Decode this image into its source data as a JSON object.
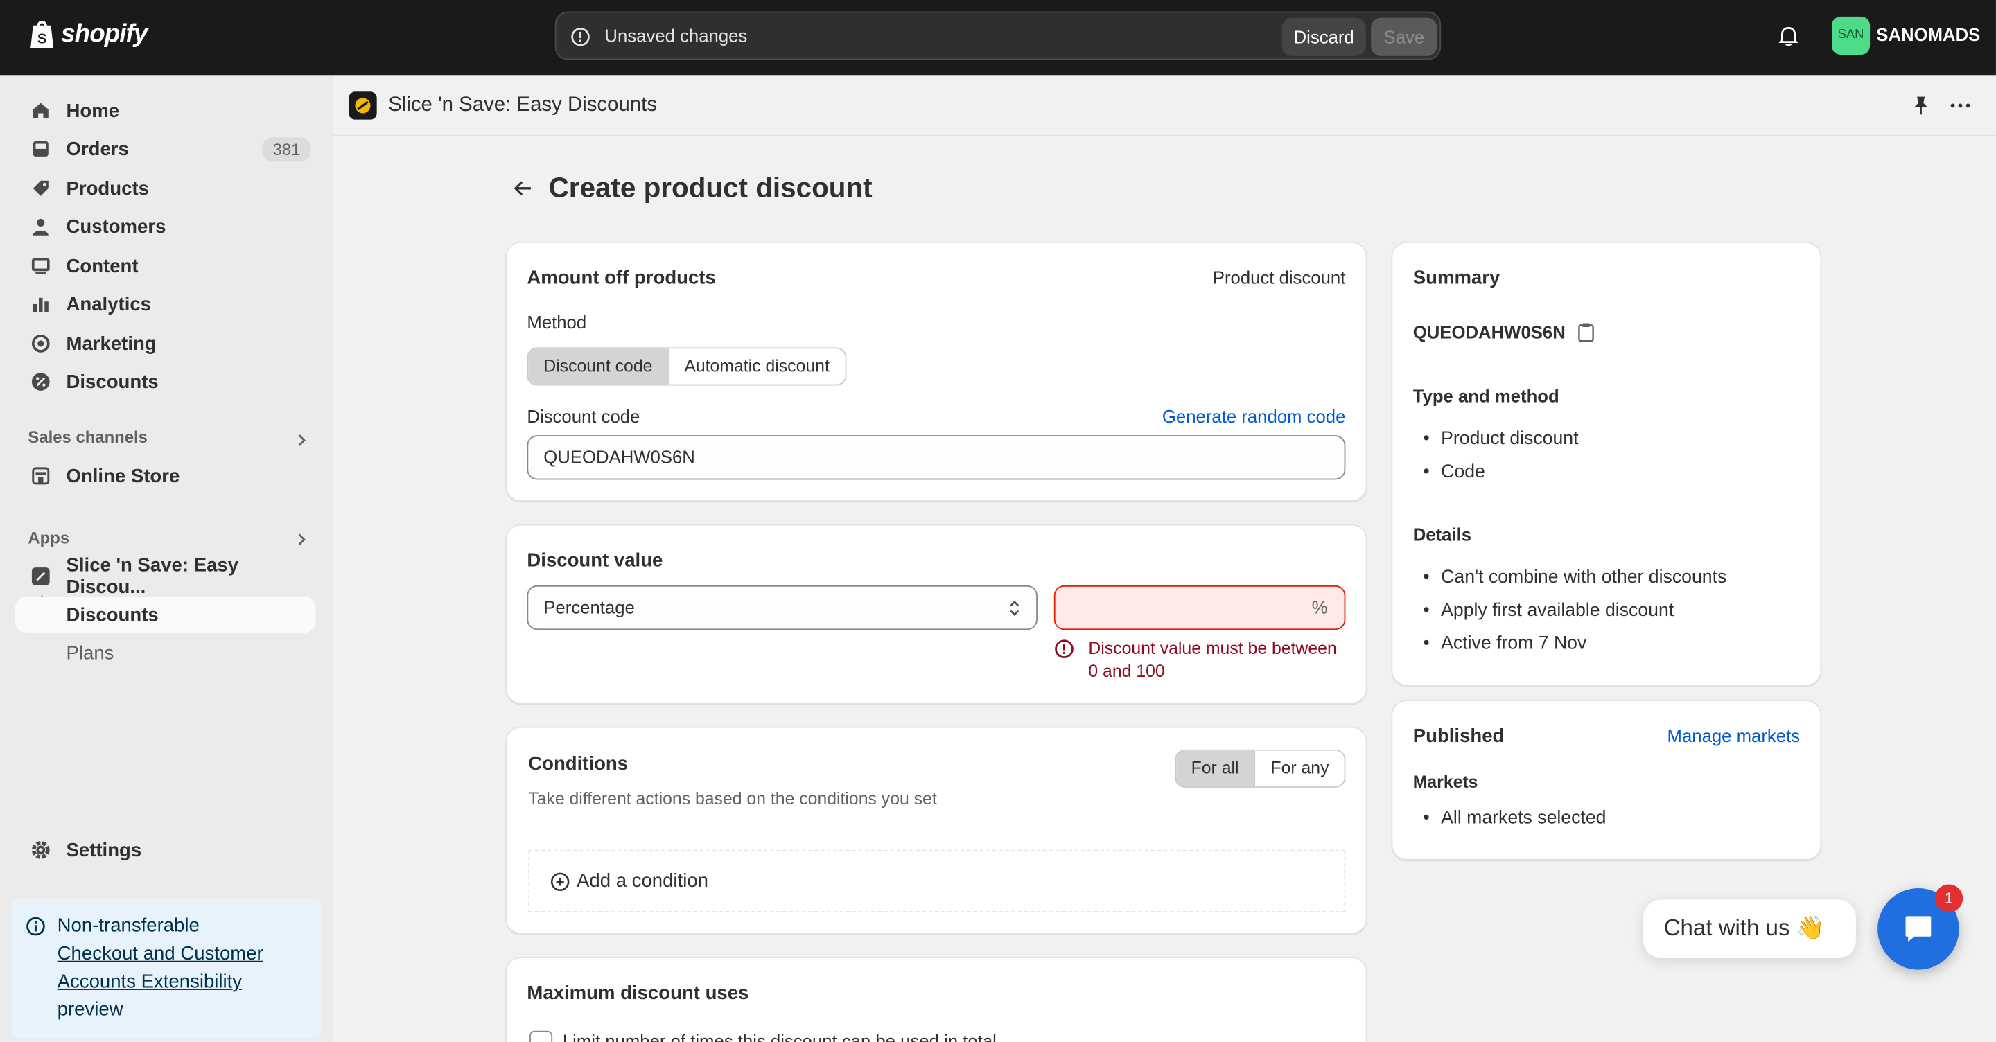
{
  "topbar": {
    "brand": "shopify",
    "unsaved": "Unsaved changes",
    "discard": "Discard",
    "save": "Save",
    "avatar_initials": "SAN",
    "store": "SANOMADS"
  },
  "sidebar": {
    "items": [
      {
        "label": "Home",
        "icon": "home-icon"
      },
      {
        "label": "Orders",
        "icon": "inbox-icon",
        "badge": "381"
      },
      {
        "label": "Products",
        "icon": "tag-icon"
      },
      {
        "label": "Customers",
        "icon": "person-icon"
      },
      {
        "label": "Content",
        "icon": "image-icon"
      },
      {
        "label": "Analytics",
        "icon": "bar-chart-icon"
      },
      {
        "label": "Marketing",
        "icon": "target-icon"
      },
      {
        "label": "Discounts",
        "icon": "discount-icon"
      }
    ],
    "sales_channels": "Sales channels",
    "online_store": "Online Store",
    "apps": "Apps",
    "app_name": "Slice 'n Save: Easy Discou...",
    "app_discounts": "Discounts",
    "app_plans": "Plans",
    "settings": "Settings",
    "notice_line1": "Non-transferable",
    "notice_link": "Checkout and Customer Accounts Extensibility",
    "notice_line3": "preview"
  },
  "header": {
    "app_title": "Slice 'n Save: Easy Discounts"
  },
  "page": {
    "title": "Create product discount"
  },
  "amount_card": {
    "title": "Amount off products",
    "type": "Product discount",
    "method_label": "Method",
    "method_options": [
      "Discount code",
      "Automatic discount"
    ],
    "code_label": "Discount code",
    "generate": "Generate random code",
    "code_value": "QUEODAHW0S6N"
  },
  "value_card": {
    "title": "Discount value",
    "type_value": "Percentage",
    "suffix": "%",
    "error": "Discount value must be between 0 and 100"
  },
  "conditions_card": {
    "title": "Conditions",
    "subtitle": "Take different actions based on the conditions you set",
    "toggle": [
      "For all",
      "For any"
    ],
    "add": "Add a condition"
  },
  "max_uses_card": {
    "title": "Maximum discount uses",
    "checkbox_label": "Limit number of times this discount can be used in total"
  },
  "summary": {
    "title": "Summary",
    "code": "QUEODAHW0S6N",
    "type_title": "Type and method",
    "type_items": [
      "Product discount",
      "Code"
    ],
    "details_title": "Details",
    "details_items": [
      "Can't combine with other discounts",
      "Apply first available discount",
      "Active from 7 Nov"
    ]
  },
  "published": {
    "title": "Published",
    "manage": "Manage markets",
    "markets_title": "Markets",
    "markets_items": [
      "All markets selected"
    ]
  },
  "chat": {
    "label": "Chat with us 👋",
    "badge": "1"
  },
  "colors": {
    "topbar": "#1a1a1a",
    "link": "#005bd3",
    "error": "#8e0b21",
    "chat": "#1f6fe0"
  }
}
